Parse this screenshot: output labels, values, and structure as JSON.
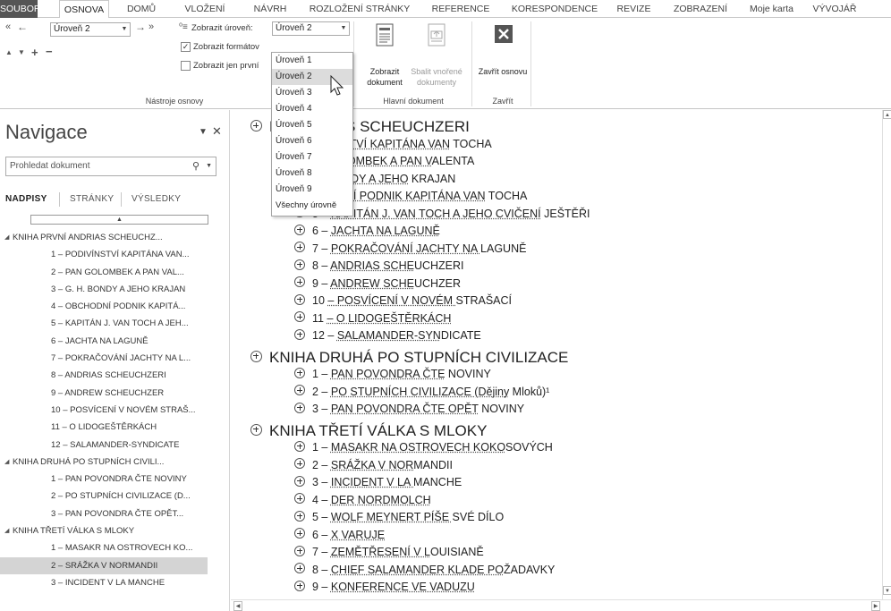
{
  "tabs": [
    {
      "label": "SOUBOR",
      "state": "file"
    },
    {
      "label": "OSNOVA",
      "state": "active"
    },
    {
      "label": "DOMŮ"
    },
    {
      "label": "VLOŽENÍ"
    },
    {
      "label": "NÁVRH"
    },
    {
      "label": "ROZLOŽENÍ STRÁNKY"
    },
    {
      "label": "REFERENCE"
    },
    {
      "label": "KORESPONDENCE"
    },
    {
      "label": "REVIZE"
    },
    {
      "label": "ZOBRAZENÍ"
    },
    {
      "label": "Moje karta"
    },
    {
      "label": "VÝVOJÁŘ"
    }
  ],
  "ribbon": {
    "outline_tools": {
      "level_value": "Úroveň 2",
      "show_level_label": "Zobrazit úroveň:",
      "show_level_value": "Úroveň 2",
      "show_formatting": "Zobrazit formátov",
      "show_first_line": "Zobrazit jen první",
      "group_label": "Nástroje osnovy"
    },
    "master_document": {
      "show_document": "Zobrazit dokument",
      "collapse_subdocs": "Sbalit vnořené dokumenty",
      "group_label": "Hlavní dokument"
    },
    "close": {
      "close_outline": "Zavřít osnovu",
      "group_label": "Zavřít"
    }
  },
  "level_dropdown": {
    "items": [
      "Úroveň 1",
      "Úroveň 2",
      "Úroveň 3",
      "Úroveň 4",
      "Úroveň 5",
      "Úroveň 6",
      "Úroveň 7",
      "Úroveň 8",
      "Úroveň 9",
      "Všechny úrovně"
    ],
    "selected": "Úroveň 2"
  },
  "navigation": {
    "title": "Navigace",
    "search_placeholder": "Prohledat dokument",
    "tabs": [
      "NADPISY",
      "STRÁNKY",
      "VÝSLEDKY"
    ],
    "active_tab": "NADPISY",
    "items": [
      {
        "label": "KNIHA PRVNÍ ANDRIAS SCHEUCHZ...",
        "level": 1
      },
      {
        "label": "1 – PODIVÍNSTVÍ KAPITÁNA VAN...",
        "level": 2
      },
      {
        "label": "2 – PAN GOLOMBEK A PAN VAL...",
        "level": 2
      },
      {
        "label": "3 – G. H. BONDY A JEHO KRAJAN",
        "level": 2
      },
      {
        "label": "4 – OBCHODNÍ PODNIK KAPITÁ...",
        "level": 2
      },
      {
        "label": "5 – KAPITÁN J. VAN TOCH A JEH...",
        "level": 2
      },
      {
        "label": "6 – JACHTA NA LAGUNĚ",
        "level": 2
      },
      {
        "label": "7 – POKRAČOVÁNÍ JACHTY NA L...",
        "level": 2
      },
      {
        "label": "8 – ANDRIAS SCHEUCHZERI",
        "level": 2
      },
      {
        "label": "9 – ANDREW SCHEUCHZER",
        "level": 2
      },
      {
        "label": "10 – POSVÍCENÍ V NOVÉM STRAŠ...",
        "level": 2
      },
      {
        "label": "11 – O LIDOGEŠTĚRKÁCH",
        "level": 2
      },
      {
        "label": "12 – SALAMANDER-SYNDICATE",
        "level": 2
      },
      {
        "label": "KNIHA DRUHÁ PO STUPNÍCH CIVILI...",
        "level": 1
      },
      {
        "label": "1 – PAN POVONDRA ČTE NOVINY",
        "level": 2
      },
      {
        "label": "2 – PO STUPNÍCH CIVILIZACE (D...",
        "level": 2
      },
      {
        "label": "3 – PAN POVONDRA ČTE OPĚT...",
        "level": 2
      },
      {
        "label": "KNIHA TŘETÍ VÁLKA S MLOKY",
        "level": 1
      },
      {
        "label": "1 – MASAKR NA OSTROVECH KO...",
        "level": 2
      },
      {
        "label": "2 – SRÁŽKA V NORMANDII",
        "level": 2,
        "selected": true
      },
      {
        "label": "3 – INCIDENT V LA MANCHE",
        "level": 2
      }
    ]
  },
  "document": {
    "lines": [
      {
        "type": "h",
        "pre": "",
        "u": "",
        "post": "NÍ ANDRIAS SCHEUCHZERI"
      },
      {
        "type": "c",
        "pre": "",
        "u": "DIVÍNSTVÍ KAPITÁNA VAN",
        "post": " TOCHA"
      },
      {
        "type": "c",
        "pre": "",
        "u": "N GOLOMBEK A PAN V",
        "post": "ALENTA"
      },
      {
        "type": "c",
        "pre": "",
        "u": "H. BONDY A JEHO",
        "post": " KRAJAN"
      },
      {
        "type": "c",
        "pre": "",
        "u": "CHODNÍ PODNIK KAPITÁNA VAN",
        "post": " TOCHA"
      },
      {
        "type": "c",
        "pre": "5 – ",
        "u": "KAPITÁN J. VAN TOCH A JEHO CVIČENÍ",
        "post": " JEŠTĚŘI"
      },
      {
        "type": "c",
        "pre": "6 – ",
        "u": "JACHTA NA LAGUNĚ",
        "post": ""
      },
      {
        "type": "c",
        "pre": "7 – ",
        "u": "POKRAČOVÁNÍ JACHTY NA ",
        "post": "LAGUNĚ"
      },
      {
        "type": "c",
        "pre": "8 – ",
        "u": "ANDRIAS SCHE",
        "post": "UCHZERI"
      },
      {
        "type": "c",
        "pre": "9 – ",
        "u": "ANDREW SCHE",
        "post": "UCHZER"
      },
      {
        "type": "c",
        "pre": "10 ",
        "u": "– POSVÍCENÍ V NOVÉM ",
        "post": "STRAŠACÍ"
      },
      {
        "type": "c",
        "pre": "11 ",
        "u": "– O LIDOGEŠTĚRKÁCH",
        "post": ""
      },
      {
        "type": "c",
        "pre": "12 – ",
        "u": "SALAMANDER-SYN",
        "post": "DICATE"
      },
      {
        "type": "h",
        "pre": "",
        "u": "",
        "post": "KNIHA DRUHÁ PO STUPNÍCH CIVILIZACE"
      },
      {
        "type": "c",
        "pre": "1 – ",
        "u": "PAN POVONDRA ČTE",
        "post": " NOVINY"
      },
      {
        "type": "c",
        "pre": "2 – ",
        "u": "PO STUPNÍCH CIVILIZACE (Dějiny",
        "post": " Mloků)¹"
      },
      {
        "type": "c",
        "pre": "3 – ",
        "u": "PAN POVONDRA ČTE OPĚT",
        "post": " NOVINY"
      },
      {
        "type": "h",
        "pre": "",
        "u": "",
        "post": "KNIHA TŘETÍ VÁLKA S MLOKY"
      },
      {
        "type": "c",
        "pre": "1 – ",
        "u": "MASAKR NA OSTROVECH KOKO",
        "post": "SOVÝCH"
      },
      {
        "type": "c",
        "pre": "2 – ",
        "u": "SRÁŽKA V NOR",
        "post": "MANDII"
      },
      {
        "type": "c",
        "pre": "3 – ",
        "u": "INCIDENT V LA ",
        "post": "MANCHE"
      },
      {
        "type": "c",
        "pre": "4 – ",
        "u": "DER NORDMOLCH",
        "post": ""
      },
      {
        "type": "c",
        "pre": "5 – ",
        "u": "WOLF MEYNERT PÍŠE ",
        "post": "SVÉ DÍLO"
      },
      {
        "type": "c",
        "pre": "6 – ",
        "u": "X VARUJE",
        "post": ""
      },
      {
        "type": "c",
        "pre": "7 – ",
        "u": "ZEMĚTŘESENÍ V L",
        "post": "OUISIANĚ"
      },
      {
        "type": "c",
        "pre": "8 – ",
        "u": "CHIEF SALAMANDER KLADE PO",
        "post": "ŽADAVKY"
      },
      {
        "type": "c",
        "pre": "9 – ",
        "u": "KONFERENCE VE VADUZU",
        "post": ""
      }
    ]
  }
}
